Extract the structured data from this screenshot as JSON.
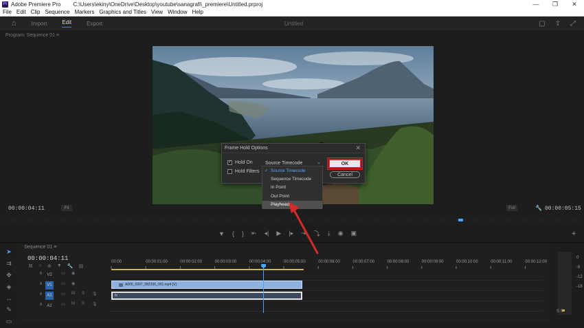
{
  "window": {
    "app_name": "Adobe Premiere Pro",
    "path": "C:\\Users\\ekiny\\OneDrive\\Desktop\\youtube\\sanagrafi\\_premiere\\Untitled.prproj",
    "logo_text": "Pr",
    "minimize": "—",
    "maximize": "❐",
    "close": "✕"
  },
  "menu": [
    "File",
    "Edit",
    "Clip",
    "Sequence",
    "Markers",
    "Graphics and Titles",
    "View",
    "Window",
    "Help"
  ],
  "workspace": {
    "tabs": [
      "Import",
      "Edit",
      "Export"
    ],
    "active_tab": "Edit",
    "center_title": "Untitled"
  },
  "program_monitor": {
    "header": "Program: Sequence 01  ≡",
    "timecode_left": "00:00:04:11",
    "timecode_right": "00:00:05:15",
    "fit_label": "Fit",
    "full_label": "Full"
  },
  "dialog": {
    "title": "Frame Hold Options",
    "close_glyph": "✕",
    "hold_on_label": "Hold On",
    "hold_on_checked": true,
    "hold_filters_label": "Hold Filters",
    "hold_filters_checked": false,
    "select_value": "Source Timecode",
    "ok_label": "OK",
    "cancel_label": "Cancel",
    "dropdown_items": [
      "Source Timecode",
      "Sequence Timecode",
      "In Point",
      "Out Point",
      "Playhead"
    ],
    "dropdown_selected_index": 0,
    "dropdown_hover_index": 4
  },
  "timeline": {
    "tab_label": "Sequence 01  ≡",
    "timecode": "00:00:04:11",
    "ruler": [
      "00:00",
      "00:00:01:00",
      "00:00:02:00",
      "00:00:03:00",
      "00:00:04:00",
      "00:00:05:00",
      "00:00:06:00",
      "00:00:07:00",
      "00:00:08:00",
      "00:00:09:00",
      "00:00:10:00",
      "00:00:11:00",
      "00:00:12:00"
    ],
    "tracks": [
      {
        "src": "",
        "name": "V2",
        "on": false
      },
      {
        "src": "V1",
        "name": "V1",
        "on": true
      },
      {
        "src": "A1",
        "name": "A1",
        "on": true
      },
      {
        "src": "",
        "name": "A2",
        "on": true
      }
    ],
    "video_clip_label": "A005_0207_082336_001.mp4 [V]",
    "audio_clip_label": "fx",
    "playhead_fraction": 0.372
  },
  "audio_meter": {
    "scale": [
      "0",
      "-6",
      "-12",
      "-18"
    ],
    "bottom": "S  S"
  },
  "colors": {
    "accent": "#2f8ae0",
    "playhead": "#4aa3ff",
    "ok_highlight": "#d0252b",
    "work_area": "#c9b64a",
    "video_clip": "#8fb1e0",
    "arrow": "#d42a2a"
  }
}
